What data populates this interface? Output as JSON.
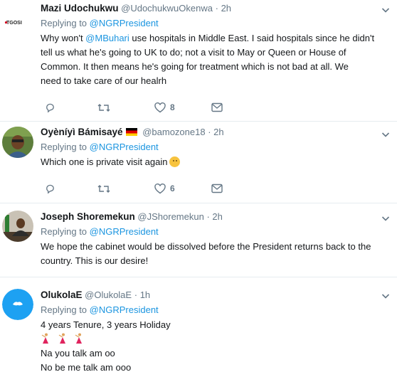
{
  "tweets": [
    {
      "name": "Mazi Udochukwu",
      "handle": "@UdochukwuOkenwa",
      "dot": "·",
      "time": "2h",
      "avatar_text": "TGOSI",
      "replying_prefix": "Replying to ",
      "replying_to": "@NGRPresident",
      "text_lines": [
        "Why won't ",
        "@MBuhari",
        " use hospitals in Middle East. I said hospitals since he didn't",
        "tell us what he's going to UK to do; not a visit to May or Queen or House of",
        "Common. It then means he's going for treatment which is not bad at all. We",
        "need to take care of our healrh"
      ],
      "like_count": "8"
    },
    {
      "name": "Oyèníyì Bámisayé",
      "handle": "@bamozone18",
      "dot": "·",
      "time": "2h",
      "replying_prefix": "Replying to ",
      "replying_to": "@NGRPresident",
      "text": "Which one is private visit again",
      "like_count": "6"
    },
    {
      "name": "Joseph Shoremekun",
      "handle": "@JShoremekun",
      "dot": "·",
      "time": "2h",
      "replying_prefix": "Replying to ",
      "replying_to": "@NGRPresident",
      "text_lines": [
        "We hope the cabinet would be dissolved before the President returns back to the",
        "country. This is our desire!"
      ]
    },
    {
      "name": "OlukolaE",
      "handle": "@OlukolaE",
      "dot": "·",
      "time": "1h",
      "replying_prefix": "Replying to ",
      "replying_to": "@NGRPresident",
      "text_lines": [
        "4 years Tenure, 3 years Holiday",
        "Na you talk am oo",
        "No be me talk am ooo"
      ]
    }
  ],
  "icons": {
    "reply": "reply-icon",
    "retweet": "retweet-icon",
    "like": "heart-icon",
    "dm": "message-icon",
    "more": "chevron-down-icon"
  },
  "colors": {
    "link": "#1b95e0",
    "muted": "#657786",
    "border": "#e6ecf0",
    "default_avatar": "#1da1f2"
  }
}
